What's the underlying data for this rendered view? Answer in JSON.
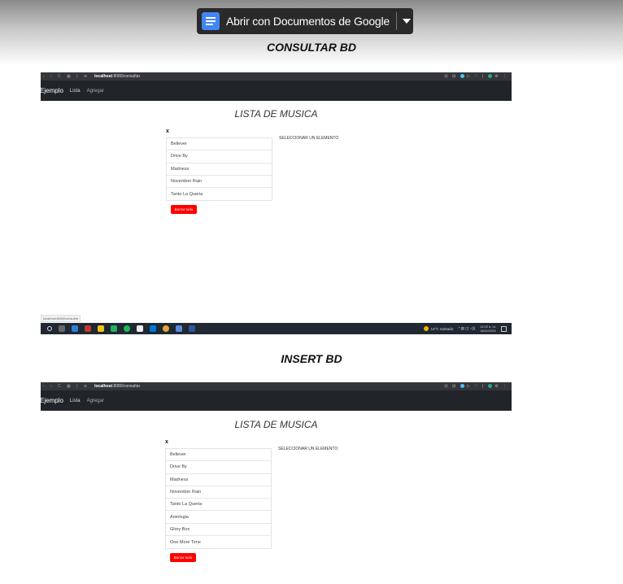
{
  "viewer": {
    "open_with_button": "Abrir con Documentos de Google",
    "docs_icon": "google-docs-icon",
    "dropdown_icon": "caret-down-icon"
  },
  "sections": [
    {
      "title": "CONSULTAR BD",
      "browser": {
        "url_host": "localhost",
        "url_path": ":8080/consultar",
        "nav_icons": [
          "back-icon",
          "forward-icon",
          "reload-icon",
          "tab-grid-icon",
          "site-info-icon"
        ]
      },
      "app": {
        "brand": "Ejemplo",
        "nav": [
          "Lista",
          "Agregar"
        ],
        "heading": "LISTA DE MUSICA",
        "close_mark": "x",
        "songs": [
          "Believer",
          "Drive By",
          "Madness",
          "November Rain",
          "Tanto La Queria"
        ],
        "select_hint": "SELECCIONAR UN ELEMENTO",
        "delete_all": "Borrar todo",
        "status_url": "localhost:8080/consultar"
      },
      "taskbar": {
        "weather": "14°C  Soleado",
        "time": "11:02 a. m.",
        "date": "18/11/2021"
      }
    },
    {
      "title": "INSERT BD",
      "browser": {
        "url_host": "localhost",
        "url_path": ":8080/consultar",
        "nav_icons": [
          "back-icon",
          "forward-icon",
          "reload-icon",
          "tab-grid-icon",
          "site-info-icon"
        ]
      },
      "app": {
        "brand": "Ejemplo",
        "nav": [
          "Lista",
          "Agregar"
        ],
        "heading": "LISTA DE MUSICA",
        "close_mark": "x",
        "songs": [
          "Believer",
          "Drive By",
          "Madness",
          "November Rain",
          "Tanto La Queria",
          "Antologia",
          "Glory Box",
          "One More Time"
        ],
        "select_hint": "SELECCIONAR UN ELEMENTO",
        "delete_all": "Borrar todo"
      }
    }
  ],
  "colors": {
    "delete_button": "#ff0000",
    "navbar": "#212529",
    "browser_chrome": "#35363a",
    "docs_blue": "#4285f4"
  }
}
